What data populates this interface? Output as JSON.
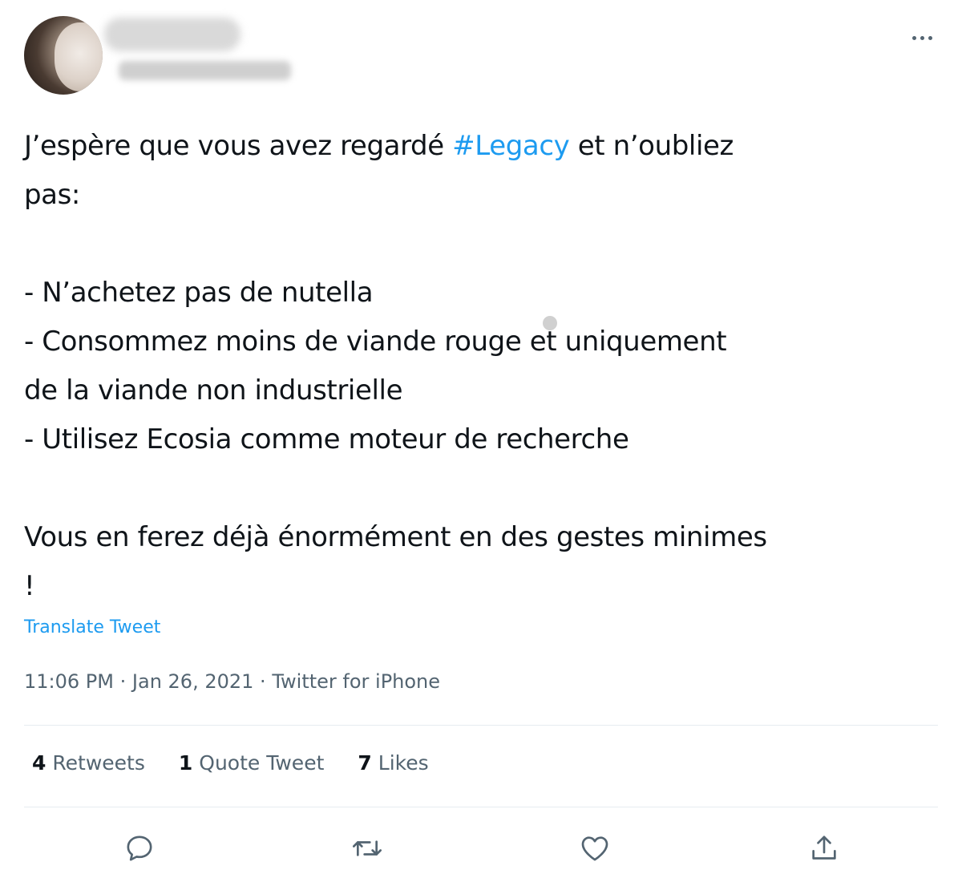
{
  "tweet": {
    "author_name": "",
    "author_handle": "",
    "text_lines": [
      {
        "before": "J’espère que vous avez regardé ",
        "hashtag": "#Legacy",
        "after": " et n’oubliez"
      },
      "pas:",
      "",
      "- N’achetez pas de nutella",
      "- Consommez moins de viande rouge et uniquement",
      "de la viande non industrielle",
      "- Utilisez Ecosia comme moteur de recherche",
      "",
      "Vous en ferez déjà énormément en des gestes minimes",
      "!"
    ],
    "translate_label": "Translate Tweet",
    "time": "11:06 PM",
    "date": "Jan 26, 2021",
    "separator": "·",
    "source": "Twitter for iPhone",
    "stats": {
      "retweets_count": "4",
      "retweets_label": "Retweets",
      "quotes_count": "1",
      "quotes_label": "Quote Tweet",
      "likes_count": "7",
      "likes_label": "Likes"
    }
  },
  "icons": {
    "more": "more-horizontal-icon",
    "reply": "reply-icon",
    "retweet": "retweet-icon",
    "like": "heart-icon",
    "share": "share-icon"
  },
  "colors": {
    "link": "#1d9bf0",
    "text": "#0f1419",
    "secondary": "#536471",
    "divider": "#e6ecf0"
  }
}
